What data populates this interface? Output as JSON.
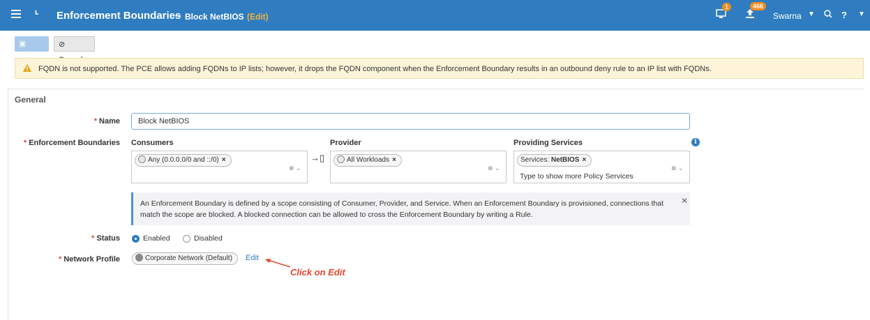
{
  "header": {
    "title": "Enforcement Boundaries",
    "separator": "–",
    "subtitle": "Block NetBIOS",
    "mode": "(Edit)",
    "notifications_count": "1",
    "uploads_count": "466",
    "user": "Swarna",
    "help": "?"
  },
  "toolbar": {
    "save_label": "Save",
    "cancel_label": "Cancel"
  },
  "warning": {
    "text": "FQDN is not supported. The PCE allows adding FQDNs to IP lists; however, it drops the FQDN component when the Enforcement Boundary results in an outbound deny rule to an IP list with FQDNs."
  },
  "general": {
    "section_title": "General",
    "name_label": "Name",
    "name_value": "Block NetBIOS",
    "boundaries_label": "Enforcement Boundaries",
    "consumers_label": "Consumers",
    "consumers_chip": "Any (0.0.0.0/0 and ::/0)",
    "provider_label": "Provider",
    "provider_chip": "All Workloads",
    "services_label": "Providing Services",
    "services_chip_prefix": "Services: ",
    "services_chip_value": "NetBIOS",
    "services_hint": "Type to show more Policy Services",
    "notice": "An Enforcement Boundary is defined by a scope consisting of Consumer, Provider, and Service. When an Enforcement Boundary is provisioned, connections that match the scope are blocked. A blocked connection can be allowed to cross the Enforcement Boundary by writing a Rule.",
    "status_label": "Status",
    "status_enabled": "Enabled",
    "status_disabled": "Disabled",
    "status_selected": "Enabled",
    "network_profile_label": "Network Profile",
    "network_profile_value": "Corporate Network (Default)",
    "edit_link": "Edit"
  },
  "annotation": {
    "text": "Click on Edit",
    "color": "#e0452b"
  },
  "colors": {
    "header": "#2f7dc0",
    "accent": "#f4b23a",
    "warning_bg": "#fdf4d9"
  }
}
